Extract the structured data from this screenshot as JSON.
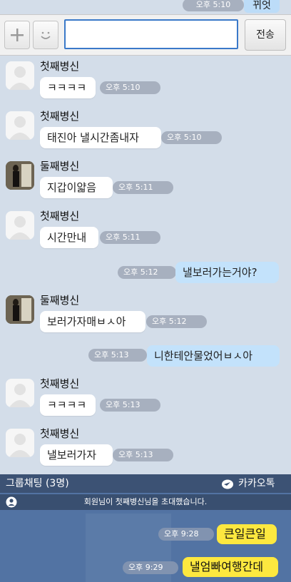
{
  "top": {
    "peek": {
      "time": "오후 5:10",
      "text": "뀌엇"
    },
    "input": {
      "value": "",
      "send_label": "전송"
    },
    "messages": [
      {
        "type": "in",
        "sender": "첫째병신",
        "text": "ㅋㅋㅋㅋ",
        "time": "오후 5:10"
      },
      {
        "type": "in",
        "sender": "첫째병신",
        "text": "태진아 낼시간좀내자",
        "time": "오후 5:10"
      },
      {
        "type": "in",
        "sender": "둘째병신",
        "text": "지갑이얇음",
        "time": "오후 5:11"
      },
      {
        "type": "in",
        "sender": "첫째병신",
        "text": "시간만내",
        "time": "오후 5:11"
      },
      {
        "type": "out",
        "text": "낼보러가는거야?",
        "time": "오후 5:12"
      },
      {
        "type": "in",
        "sender": "둘째병신",
        "text": "보러가자매ㅂㅅ아",
        "time": "오후 5:12"
      },
      {
        "type": "out",
        "text": "니한테안물었어ㅂㅅ아",
        "time": "오후 5:13"
      },
      {
        "type": "in",
        "sender": "첫째병신",
        "text": "ㅋㅋㅋㅋ",
        "time": "오후 5:13"
      },
      {
        "type": "in",
        "sender": "첫째병신",
        "text": "낼보러가자",
        "time": "오후 5:13"
      }
    ]
  },
  "bottom": {
    "header": {
      "title": "그룹채팅 (3명)",
      "brand": "카카오톡"
    },
    "notice": "회원님이 첫째병신님을 초대했습니다.",
    "messages": [
      {
        "text": "큰일큰일",
        "time": "오후 9:28"
      },
      {
        "text": "낼엄빠여행간데",
        "time": "오후 9:29"
      }
    ]
  },
  "colors": {
    "chat_bg_top": "#d3dde9",
    "chat_bg_bottom": "#5273a3",
    "bubble_out": "#c3e2fb",
    "bubble_yellow": "#fde83f",
    "input_border": "#3a79c9"
  }
}
